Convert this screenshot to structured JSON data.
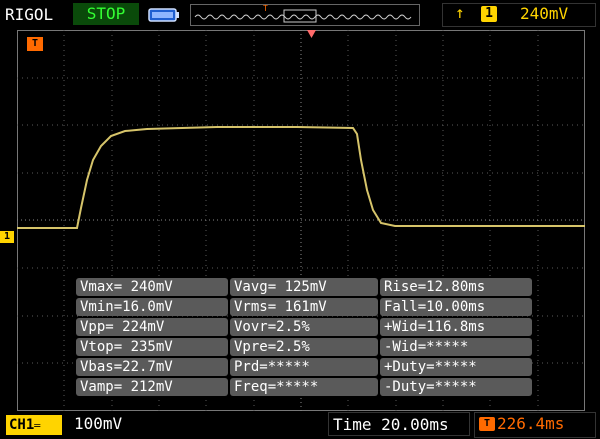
{
  "header": {
    "brand": "RIGOL",
    "run_state": "STOP",
    "trigger": {
      "edge_symbol": "↑",
      "channel": "1",
      "level": "240mV",
      "marker": "T"
    }
  },
  "markers": {
    "channel_ground": "1",
    "trigger_time": "T"
  },
  "measurements": [
    [
      "Vmax= 240mV",
      "Vavg= 125mV",
      "Rise=12.80ms"
    ],
    [
      "Vmin=16.0mV",
      "Vrms= 161mV",
      "Fall=10.00ms"
    ],
    [
      "Vpp= 224mV",
      "Vovr=2.5%",
      "+Wid=116.8ms"
    ],
    [
      "Vtop= 235mV",
      "Vpre=2.5%",
      "-Wid=*****"
    ],
    [
      "Vbas=22.7mV",
      "Prd=*****",
      "+Duty=*****"
    ],
    [
      "Vamp= 212mV",
      "Freq=*****",
      "-Duty=*****"
    ]
  ],
  "footer": {
    "channel_label": "CH1",
    "channel_scale": "100mV",
    "timebase": "Time 20.00ms",
    "trigger_position": "226.4ms"
  },
  "colors": {
    "trace": "#d6c46a",
    "grid": "#5a5a5a",
    "trigger": "#ffd400",
    "time_marker": "#ff6a00",
    "run_state": "#33ff33"
  }
}
